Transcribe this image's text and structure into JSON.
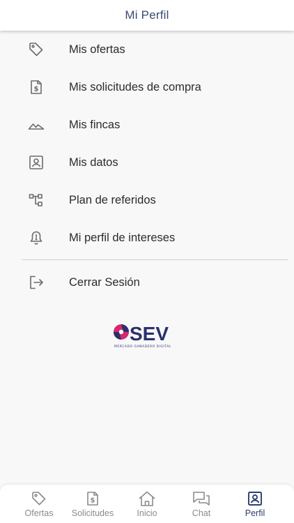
{
  "header": {
    "title": "Mi Perfil"
  },
  "menu": {
    "items": [
      {
        "label": "Mis ofertas",
        "icon": "tag-icon"
      },
      {
        "label": "Mis solicitudes de compra",
        "icon": "dollar-document-icon"
      },
      {
        "label": "Mis fincas",
        "icon": "landscape-icon"
      },
      {
        "label": "Mis datos",
        "icon": "account-box-icon"
      },
      {
        "label": "Plan de referidos",
        "icon": "hierarchy-icon"
      },
      {
        "label": "Mi perfil de intereses",
        "icon": "bell-alert-icon"
      }
    ],
    "logout": {
      "label": "Cerrar Sesión",
      "icon": "logout-icon"
    }
  },
  "logo": {
    "text": "SEV",
    "tagline": "MERCADO GANADERO DIGITAL"
  },
  "bottom_nav": {
    "items": [
      {
        "label": "Ofertas",
        "icon": "tag-icon"
      },
      {
        "label": "Solicitudes",
        "icon": "dollar-document-icon"
      },
      {
        "label": "Inicio",
        "icon": "home-icon"
      },
      {
        "label": "Chat",
        "icon": "chat-icon"
      },
      {
        "label": "Perfil",
        "icon": "account-box-icon",
        "active": true
      }
    ]
  },
  "colors": {
    "accent": "#2d3d70",
    "icon_gray": "#6b6b6b",
    "logo_pink": "#d6276f",
    "logo_navy": "#2a2f6e"
  }
}
